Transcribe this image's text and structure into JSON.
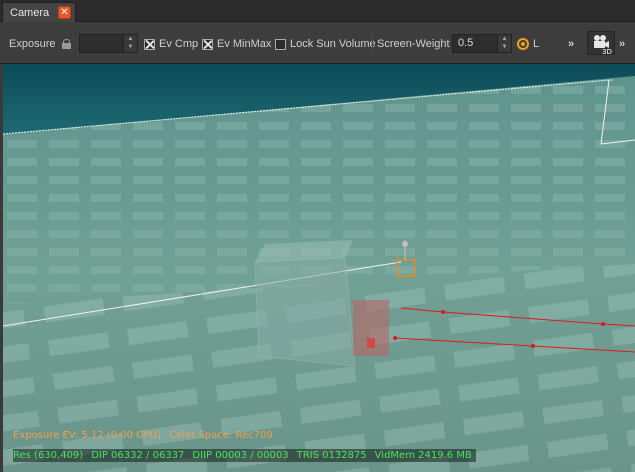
{
  "tab": {
    "label": "Camera",
    "close_glyph": "✕"
  },
  "toolbar": {
    "exposure_label": "Exposure",
    "exposure_value": "",
    "ev_cmp": {
      "label": "Ev Cmp",
      "checked": true
    },
    "ev_minmax": {
      "label": "Ev MinMax",
      "checked": true
    },
    "lock_sun_volume": {
      "label": "Lock Sun Volume",
      "checked": false
    },
    "screen_weight_label": "Screen-Weight",
    "screen_weight_value": "0.5",
    "l_radio_label": "L",
    "overflow_glyph": "»",
    "view_mode_badge": "3D"
  },
  "viewport": {
    "exposure_info": {
      "exposure_ev": "Exposure EV: 5.12 (0.00 GPU)",
      "color_space": "Color Space: Rec709"
    },
    "stats": {
      "res": "Res (630,409)",
      "dip": "DIP 06332 / 06337",
      "diip": "DIIP 00003 / 00003",
      "tris": "TRIS 0132875",
      "vidmem": "VidMem 2419.6 MB"
    }
  },
  "colors": {
    "accent_orange": "#f0a020",
    "close_red": "#e8582b",
    "overlay_green": "#49e35a",
    "overlay_orange": "#f0a050",
    "path_red": "#d91c1c"
  }
}
